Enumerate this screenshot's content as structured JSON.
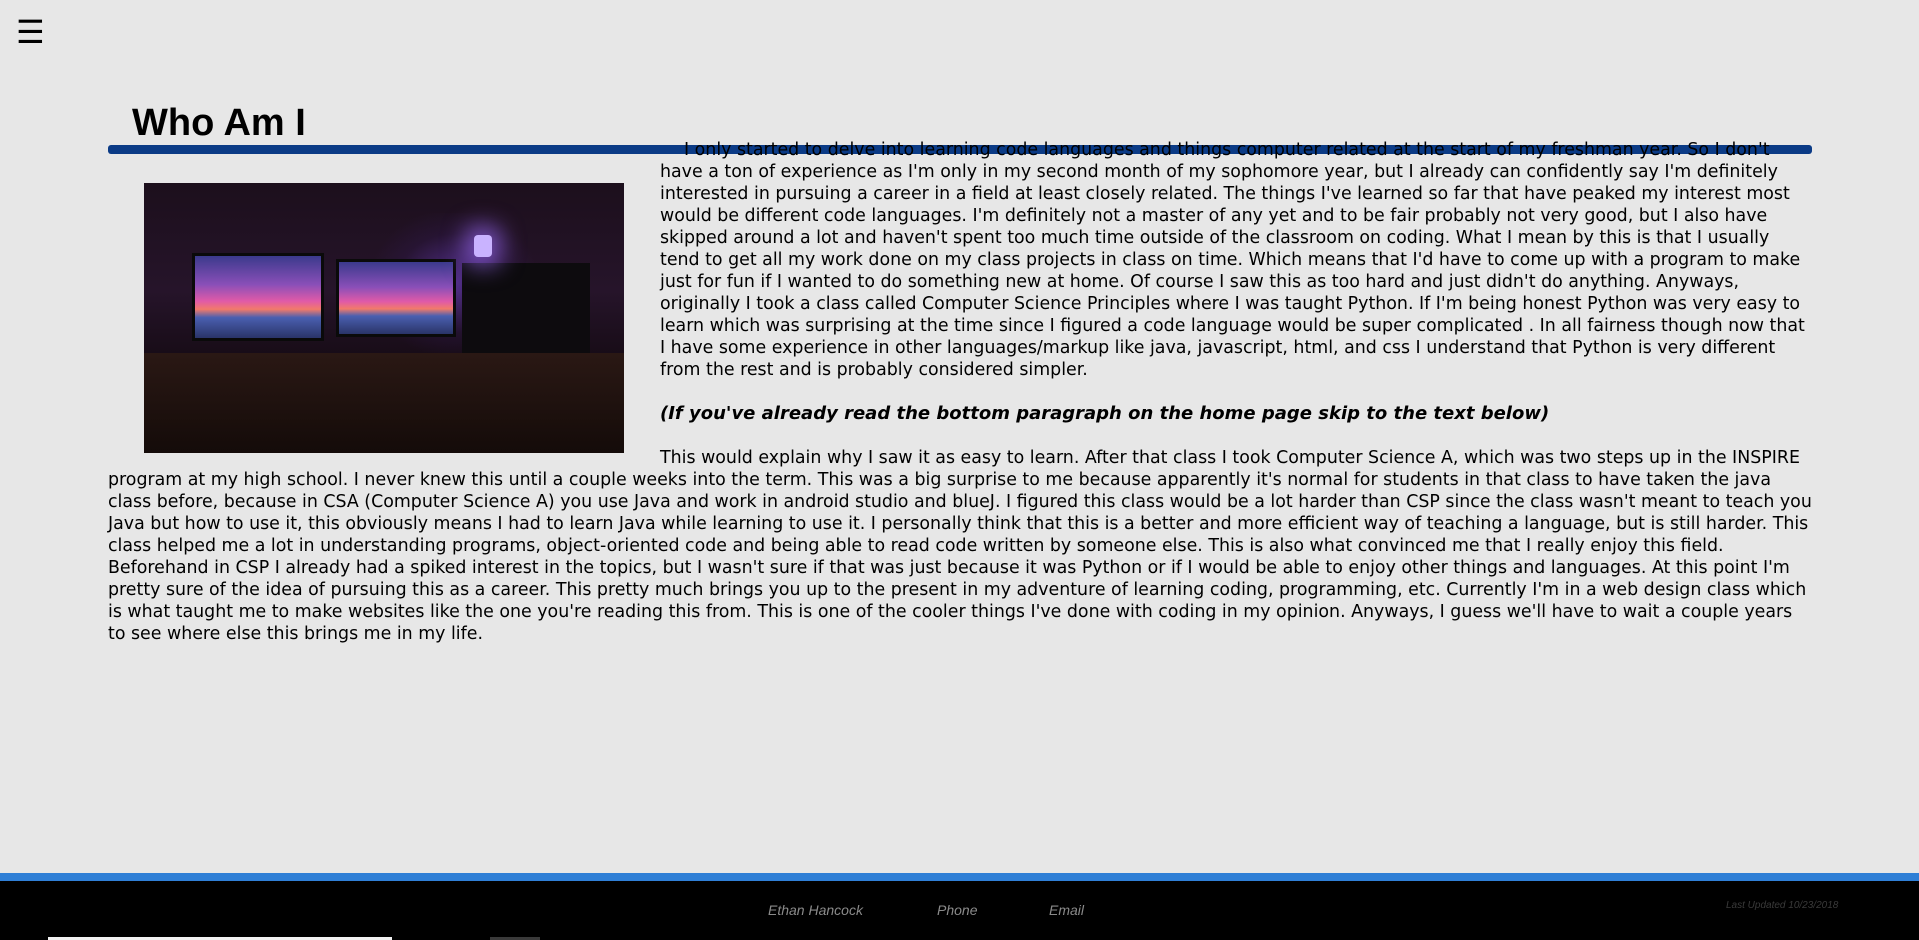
{
  "nav": {
    "menu_icon": "hamburger-menu-icon",
    "menu_glyph": "☰"
  },
  "page": {
    "title": "Who Am I",
    "accent_color": "#0b3b86"
  },
  "content": {
    "intro_paragraph": "I only started to delve into learning code languages and things computer related at the start of my freshman year. So I don't have a ton of experience as I'm only in my second month of my sophomore year, but I already can confidently say I'm definitely interested in pursuing a career in a field at least closely related. The things I've learned so far that have peaked my interest most would be different code languages. I'm definitely not a master of any yet and to be fair probably not very good, but I also have skipped around a lot and haven't spent too much time outside of the classroom on coding. What I mean by this is that I usually tend to get all my work done on my class projects in class on time. Which means that I'd have to come up with a program to make just for fun if I wanted to do something new at home. Of course I saw this as too hard and just didn't do anything. Anyways, originally I took a class called Computer Science Principles where I was taught Python. If I'm being honest Python was very easy to learn which was surprising at the time since I figured a code language would be super complicated . In all fairness though now that I have some experience in other languages/markup like java, javascript, html, and css I understand that Python is very different from the rest and is probably considered simpler.",
    "skip_note": "(If you've already read the bottom paragraph on the home page skip to the text below)",
    "main_paragraph": "This would explain why I saw it as easy to learn. After that class I took Computer Science A, which was two steps up in the INSPIRE program at my high school. I never knew this until a couple weeks into the term. This was a big surprise to me because apparently it's normal for students in that class to have taken the java class before, because in CSA (Computer Science A) you use Java and work in android studio and blueJ. I figured this class would be a lot harder than CSP since the class wasn't meant to teach you Java but how to use it, this obviously means I had to learn Java while learning to use it. I personally think that this is a better and more efficient way of teaching a language, but is still harder. This class helped me a lot in understanding programs, object-oriented code and being able to read code written by someone else. This is also what convinced me that I really enjoy this field. Beforehand in CSP I already had a spiked interest in the topics, but I wasn't sure if that was just because it was Python or if I would be able to enjoy other things and languages. At this point I'm pretty sure of the idea of pursuing this as a career. This pretty much brings you up to the present in my adventure of learning coding, programming, etc. Currently I'm in a web design class which is what taught me to make websites like the one you're reading this from. This is one of the cooler things I've done with coding in my opinion. Anyways, I guess we'll have to wait a couple years to see where else this brings me in my life."
  },
  "footer": {
    "name": "Ethan Hancock",
    "phone_label": "Phone",
    "email_label": "Email",
    "last_updated": "Last Updated 10/23/2018",
    "stripe_color": "#2f7fd6",
    "background_color": "#000000"
  }
}
